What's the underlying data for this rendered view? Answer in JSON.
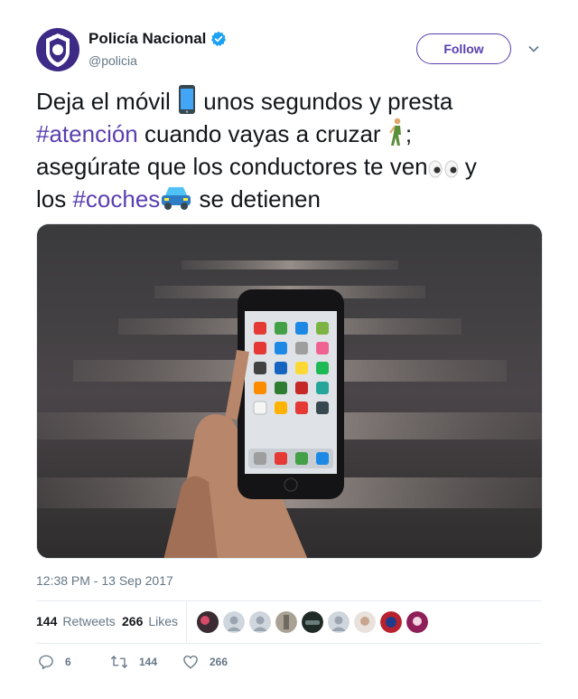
{
  "header": {
    "display_name": "Policía Nacional",
    "handle": "@policia",
    "follow_label": "Follow",
    "verified": true
  },
  "tweet": {
    "part1": "Deja el móvil",
    "part2": " unos segundos y presta",
    "hashtag1": "#atención",
    "part3": " cuando vayas a cruzar",
    "part4": ";",
    "part5": "asegúrate que los conductores te ven",
    "part6": " y",
    "part7": "los ",
    "hashtag2": "#coches",
    "part8": " se detienen",
    "emojis": [
      "mobile-phone-icon",
      "pedestrian-icon",
      "eyes-icon",
      "car-icon"
    ]
  },
  "media": {
    "description_icon": "phone-at-crosswalk-photo"
  },
  "timestamp": "12:38 PM - 13 Sep 2017",
  "stats": {
    "retweets_count": "144",
    "retweets_label": "Retweets",
    "likes_count": "266",
    "likes_label": "Likes"
  },
  "actions": {
    "reply_count": "6",
    "retweet_count": "144",
    "like_count": "266"
  },
  "colors": {
    "accent": "#5a3fb0",
    "verified": "#1da1f2",
    "muted": "#657786"
  }
}
